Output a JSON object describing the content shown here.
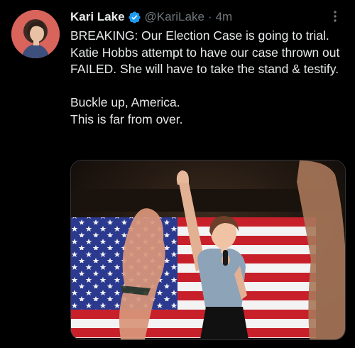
{
  "tweet": {
    "author": {
      "display_name": "Kari Lake",
      "handle": "@KariLake",
      "verified": true
    },
    "separator": "·",
    "timestamp": "4m",
    "text_paragraphs": [
      "BREAKING: Our Election Case is going to trial. Katie Hobbs attempt to have our case thrown out FAILED. She will have to take the stand & testify.",
      "Buckle up, America.\nThis is far from over."
    ]
  },
  "icons": {
    "verified": "verified-badge-icon",
    "more": "more-options-icon"
  },
  "colors": {
    "background": "#000000",
    "text": "#e7e9ea",
    "secondary_text": "#71767b",
    "verified_blue": "#1d9bf0",
    "avatar_bg": "#d5655e"
  }
}
